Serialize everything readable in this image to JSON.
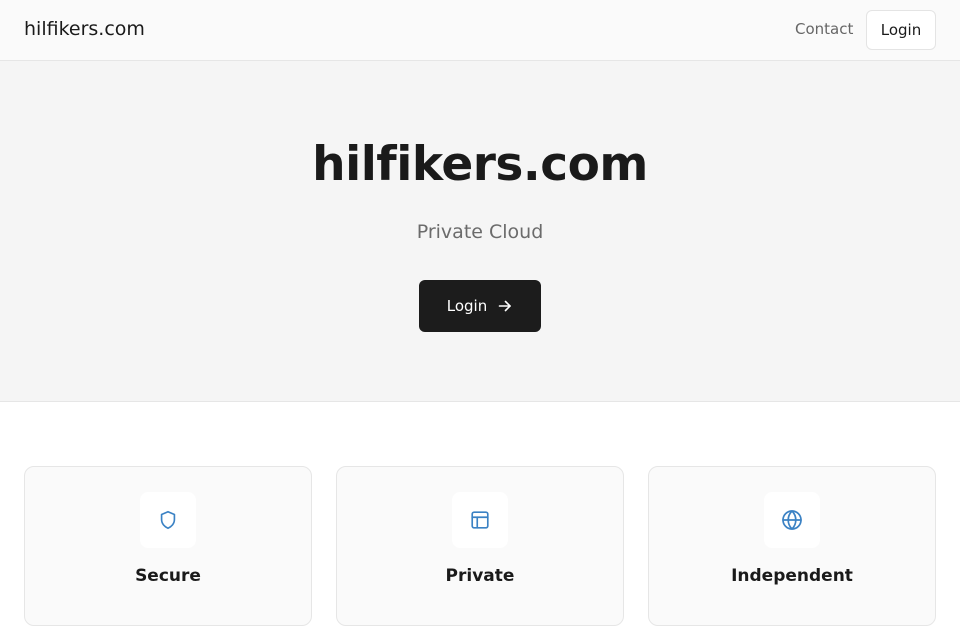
{
  "header": {
    "brand": "hilfikers.com",
    "nav": {
      "contact": "Contact",
      "login": "Login"
    }
  },
  "hero": {
    "title": "hilfikers.com",
    "subtitle": "Private Cloud",
    "login_button": "Login",
    "login_icon": "arrow-right-icon"
  },
  "features": [
    {
      "title": "Secure",
      "icon": "shield-icon"
    },
    {
      "title": "Private",
      "icon": "layout-icon"
    },
    {
      "title": "Independent",
      "icon": "globe-icon"
    }
  ],
  "colors": {
    "accent": "#3b82c4",
    "button_dark": "#1c1c1c",
    "hero_bg": "#f5f5f5"
  }
}
